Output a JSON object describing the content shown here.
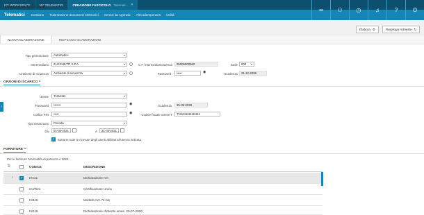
{
  "tabs": [
    {
      "label": "MY WORKSPACE"
    },
    {
      "label": "MY TELEMATICI"
    },
    {
      "label": "CREAZIONE FASCICOLO",
      "sub": "Telemati..."
    }
  ],
  "nav": {
    "brand": "Telematici",
    "items": [
      "Gestione",
      "Trasmissione documenti elettronici",
      "Servizi da Agenzia",
      "Altri adempimenti",
      "Utilità"
    ]
  },
  "page": {
    "title": "Creazione fascicolo",
    "elabora": "Elabora",
    "riepilogo": "Riepilogo richieste"
  },
  "subtabs": [
    "NUOVA ELABORAZIONE",
    "RIEPILOGO ELABORAZIONI"
  ],
  "form": {
    "tipo_generazione_label": "Tipo generazione",
    "tipo_generazione": "Automatico",
    "intermediario_label": "Intermediario",
    "intermediario": "ZUCCHETTI S.P.A.",
    "cf_label": "C.F. Intermediario/utenza",
    "cf": "05006900962",
    "sede_label": "Sede",
    "sede": "000",
    "ambiente_label": "Ambiente di sicurezza",
    "ambiente": "Ambiente di sicurezza",
    "password_label": "Password",
    "password": "•••••",
    "scadenza_label": "Scadenza",
    "scadenza": "31-12-2099"
  },
  "opzioni": {
    "title": "OPZIONI DI SCARICO",
    "utente_label": "Utente",
    "utente": "T1111111",
    "password_label": "Password",
    "password": "•••••••",
    "scadenza_label": "Scadenza",
    "scadenza": "15-08-2030",
    "pin_label": "Codice PIN",
    "pin": "•••••",
    "cf_utente_label": "Codice fiscale utente T",
    "cf_utente": "T111111111111111",
    "tipo_estrazione_label": "Tipo Estrazione",
    "tipo_estrazione": "Periodo",
    "da_label": "Da",
    "da": "01-03-2021",
    "a_label": "A",
    "a": "31-03-2021",
    "estrarre_label": "Estrarre tutte le ricevute degli utenti abilitati all'utenza indicata"
  },
  "forniture": {
    "title": "FORNITURE",
    "note": "Per le forniture IVA/multifa di partenza è 2021",
    "col_codice": "CODICE",
    "col_descrizione": "DESCRIZIONE",
    "rows": [
      {
        "codice": "IVA21",
        "descrizione": "Dichiarazione IVA",
        "checked": true
      },
      {
        "codice": "CU/R21",
        "descrizione": "Certificazione Unica",
        "checked": false
      },
      {
        "codice": "IVB18",
        "descrizione": "Modello IVA 74-bis",
        "checked": false
      },
      {
        "codice": "IVE15",
        "descrizione": "Dichiarazione d'intento emes. 20-07-2020",
        "checked": false
      }
    ]
  }
}
